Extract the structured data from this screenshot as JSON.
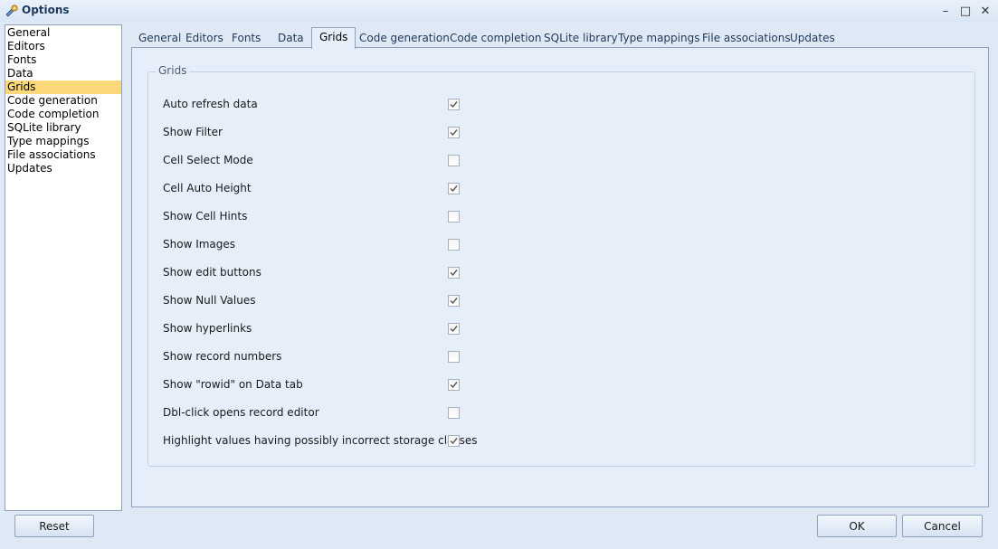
{
  "window": {
    "title": "Options",
    "minimize_symbol": "–",
    "maximize_symbol": "□",
    "close_symbol": "✕",
    "app_icon": "options-app-icon"
  },
  "sidebar": {
    "items": [
      {
        "label": "General"
      },
      {
        "label": "Editors"
      },
      {
        "label": "Fonts"
      },
      {
        "label": "Data"
      },
      {
        "label": "Grids",
        "selected": true
      },
      {
        "label": "Code generation"
      },
      {
        "label": "Code completion"
      },
      {
        "label": "SQLite library"
      },
      {
        "label": "Type mappings"
      },
      {
        "label": "File associations"
      },
      {
        "label": "Updates"
      }
    ]
  },
  "tabs": [
    {
      "label": "General"
    },
    {
      "label": "Editors"
    },
    {
      "label": "Fonts"
    },
    {
      "label": "Data"
    },
    {
      "label": "Grids",
      "active": true
    },
    {
      "label": "Code generation"
    },
    {
      "label": "Code completion"
    },
    {
      "label": "SQLite library"
    },
    {
      "label": "Type mappings"
    },
    {
      "label": "File associations"
    },
    {
      "label": "Updates"
    }
  ],
  "grids": {
    "group_title": "Grids",
    "options": [
      {
        "label": "Auto refresh data",
        "checked": true
      },
      {
        "label": "Show Filter",
        "checked": true
      },
      {
        "label": "Cell Select Mode",
        "checked": false
      },
      {
        "label": "Cell Auto Height",
        "checked": true
      },
      {
        "label": "Show Cell Hints",
        "checked": false
      },
      {
        "label": "Show Images",
        "checked": false
      },
      {
        "label": "Show edit buttons",
        "checked": true
      },
      {
        "label": "Show Null Values",
        "checked": true
      },
      {
        "label": "Show hyperlinks",
        "checked": true
      },
      {
        "label": "Show record numbers",
        "checked": false
      },
      {
        "label": "Show \"rowid\" on Data tab",
        "checked": true
      },
      {
        "label": "Dbl-click opens record editor",
        "checked": false
      },
      {
        "label": "Highlight values having possibly incorrect storage classes",
        "checked": true
      }
    ]
  },
  "buttons": {
    "reset": "Reset",
    "ok": "OK",
    "cancel": "Cancel"
  },
  "colors": {
    "selected_item": "#fbd97a",
    "panel_bg": "#e6eef9",
    "window_bg": "#dfe9f5",
    "border": "#8da2be"
  }
}
